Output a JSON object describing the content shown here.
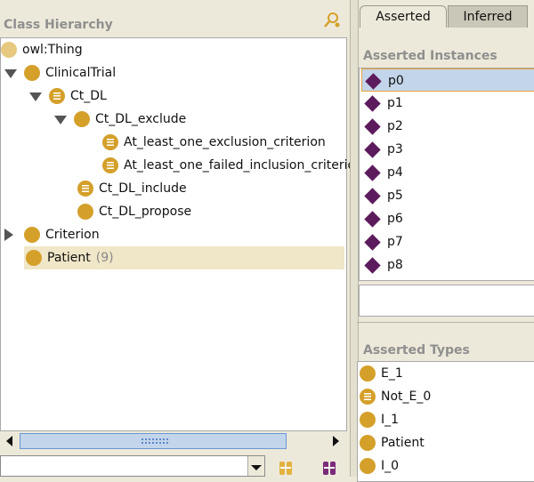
{
  "class_hierarchy": {
    "title": "Class Hierarchy",
    "search_icon": "find-class-icon",
    "items": [
      {
        "label": "owl:Thing",
        "icon": "thing-circle",
        "toggle": "none",
        "count": ""
      },
      {
        "label": "ClinicalTrial",
        "icon": "class-circle",
        "toggle": "expanded",
        "count": ""
      },
      {
        "label": "Ct_DL",
        "icon": "defined-class-circle",
        "toggle": "expanded",
        "count": ""
      },
      {
        "label": "Ct_DL_exclude",
        "icon": "class-circle",
        "toggle": "expanded",
        "count": ""
      },
      {
        "label": "At_least_one_exclusion_criterion",
        "icon": "defined-class-circle",
        "toggle": "none",
        "count": ""
      },
      {
        "label": "At_least_one_failed_inclusion_criterion",
        "icon": "defined-class-circle",
        "toggle": "none",
        "count": ""
      },
      {
        "label": "Ct_DL_include",
        "icon": "defined-class-circle",
        "toggle": "none",
        "count": ""
      },
      {
        "label": "Ct_DL_propose",
        "icon": "class-circle",
        "toggle": "none",
        "count": ""
      },
      {
        "label": "Criterion",
        "icon": "class-circle",
        "toggle": "collapsed",
        "count": ""
      },
      {
        "label": "Patient",
        "icon": "class-circle",
        "toggle": "none",
        "count": "(9)",
        "selected": true
      }
    ]
  },
  "search_combo": {
    "value": "",
    "placeholder": ""
  },
  "tabs": [
    {
      "label": "Asserted",
      "active": true
    },
    {
      "label": "Inferred",
      "active": false
    }
  ],
  "instances": {
    "title": "Asserted Instances",
    "items": [
      "p0",
      "p1",
      "p2",
      "p3",
      "p4",
      "p5",
      "p6",
      "p7",
      "p8"
    ],
    "selected": "p0"
  },
  "types": {
    "title": "Asserted Types",
    "items": [
      {
        "label": "E_1",
        "icon": "class-circle"
      },
      {
        "label": "Not_E_0",
        "icon": "defined-class-circle"
      },
      {
        "label": "I_1",
        "icon": "class-circle"
      },
      {
        "label": "Patient",
        "icon": "class-circle"
      },
      {
        "label": "I_0",
        "icon": "class-circle"
      }
    ]
  },
  "colors": {
    "class": "#d4a02a",
    "instance": "#5c1b5c",
    "selection": "#c3d5ea",
    "highlight": "#f0e6c8",
    "panel_bg": "#ede9da"
  }
}
